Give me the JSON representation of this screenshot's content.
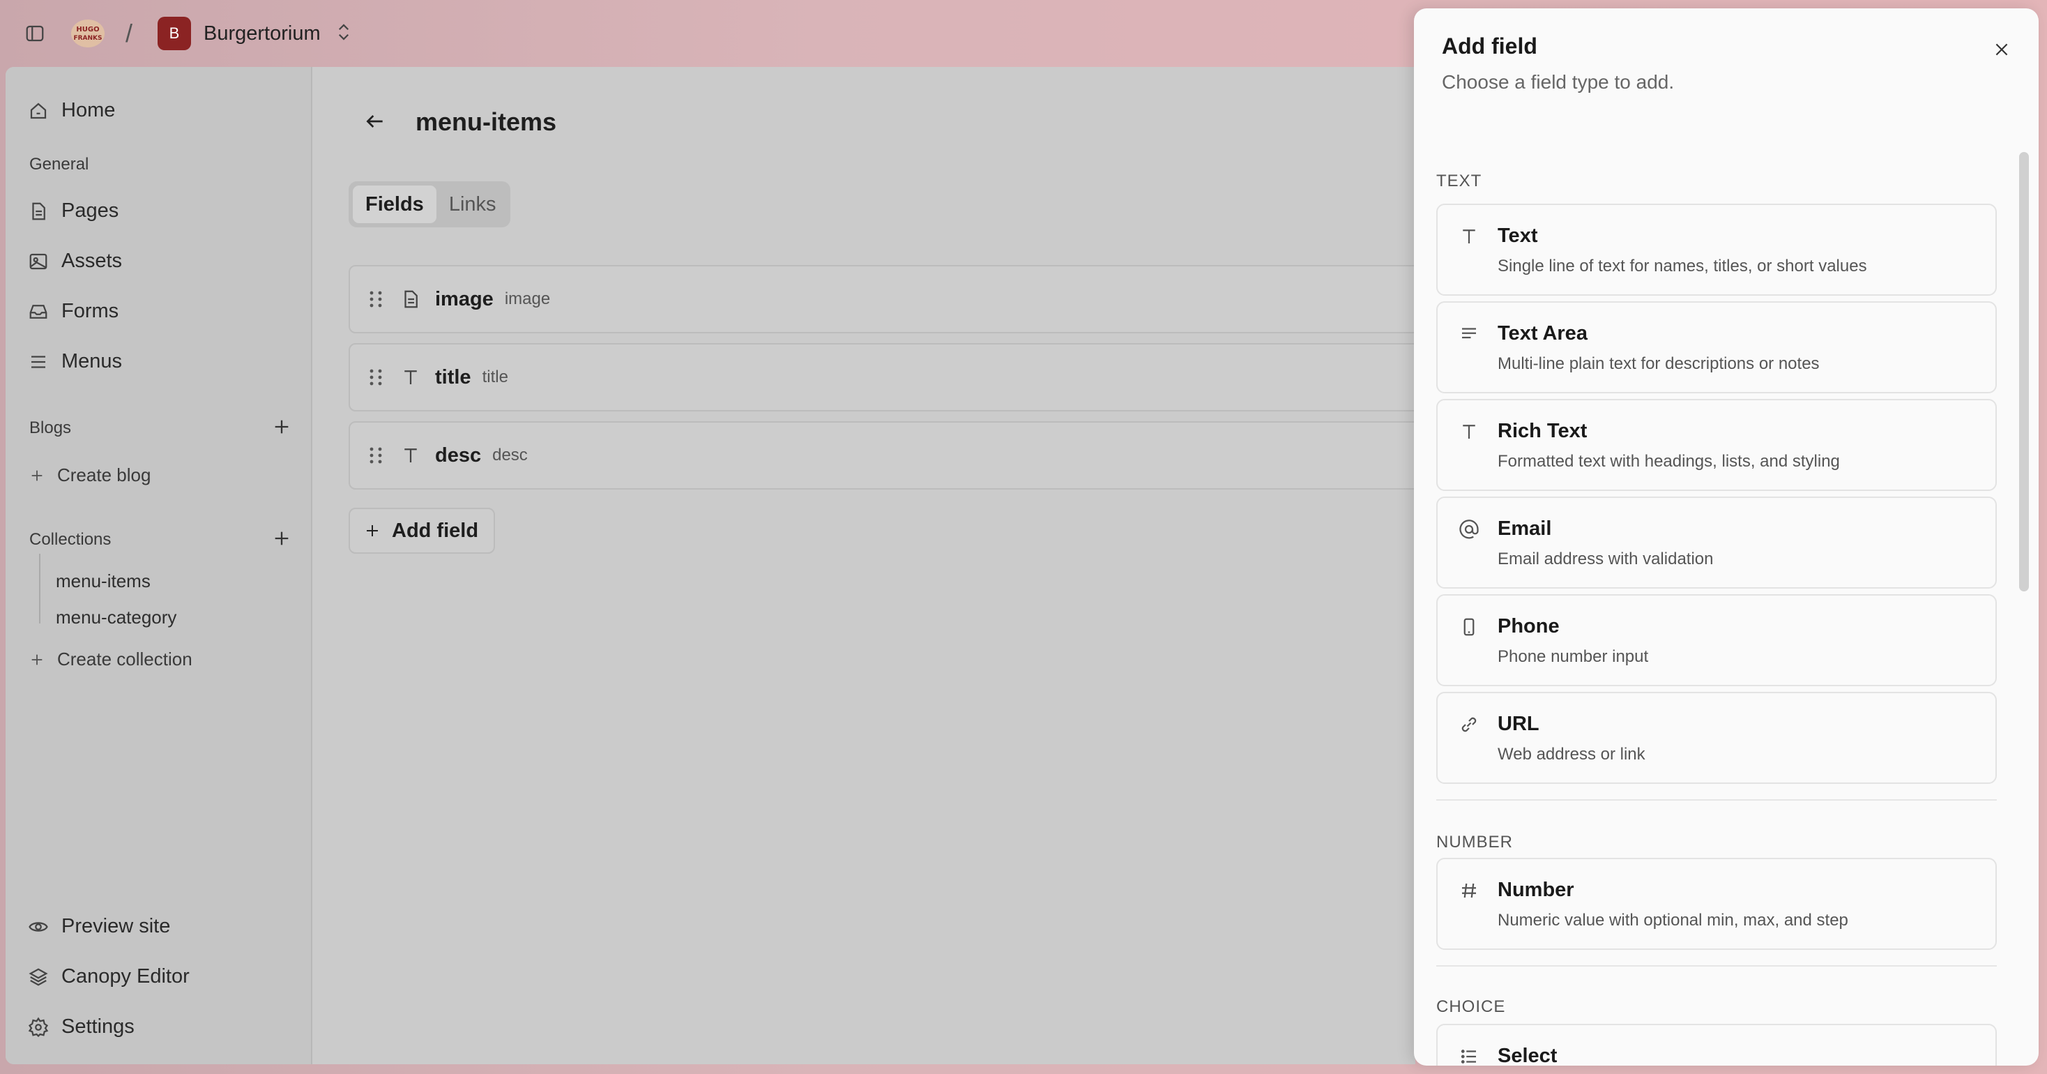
{
  "topbar": {
    "org_initial": "B",
    "org_name": "Burgertorium",
    "logo_text": "HUGO FRANKS"
  },
  "sidebar": {
    "home": "Home",
    "general_label": "General",
    "general_items": [
      "Pages",
      "Assets",
      "Forms",
      "Menus"
    ],
    "blogs_label": "Blogs",
    "create_blog": "Create blog",
    "collections_label": "Collections",
    "collections": [
      "menu-items",
      "menu-category"
    ],
    "create_collection": "Create collection",
    "footer_items": [
      "Preview site",
      "Canopy Editor",
      "Settings"
    ]
  },
  "main": {
    "title": "menu-items",
    "tabs": [
      "Fields",
      "Links"
    ],
    "fields": [
      {
        "name": "image",
        "key": "image",
        "icon": "file-icon"
      },
      {
        "name": "title",
        "key": "title",
        "icon": "text-icon"
      },
      {
        "name": "desc",
        "key": "desc",
        "icon": "text-icon"
      }
    ],
    "add_field_label": "Add field"
  },
  "drawer": {
    "title": "Add field",
    "subtitle": "Choose a field type to add.",
    "groups": {
      "text_label": "TEXT",
      "number_label": "NUMBER",
      "choice_label": "CHOICE"
    },
    "types": [
      {
        "name": "Text",
        "desc": "Single line of text for names, titles, or short values",
        "icon": "text-icon"
      },
      {
        "name": "Text Area",
        "desc": "Multi-line plain text for descriptions or notes",
        "icon": "lines-icon"
      },
      {
        "name": "Rich Text",
        "desc": "Formatted text with headings, lists, and styling",
        "icon": "text-icon"
      },
      {
        "name": "Email",
        "desc": "Email address with validation",
        "icon": "at-icon"
      },
      {
        "name": "Phone",
        "desc": "Phone number input",
        "icon": "phone-icon"
      },
      {
        "name": "URL",
        "desc": "Web address or link",
        "icon": "link-icon"
      },
      {
        "name": "Number",
        "desc": "Numeric value with optional min, max, and step",
        "icon": "hash-icon"
      },
      {
        "name": "Select",
        "desc": "",
        "icon": "list-icon"
      }
    ]
  },
  "colors": {
    "org_badge": "#8b2323",
    "backdrop_overlay": "#cbcbcb",
    "drawer_bg": "#fafafa"
  }
}
